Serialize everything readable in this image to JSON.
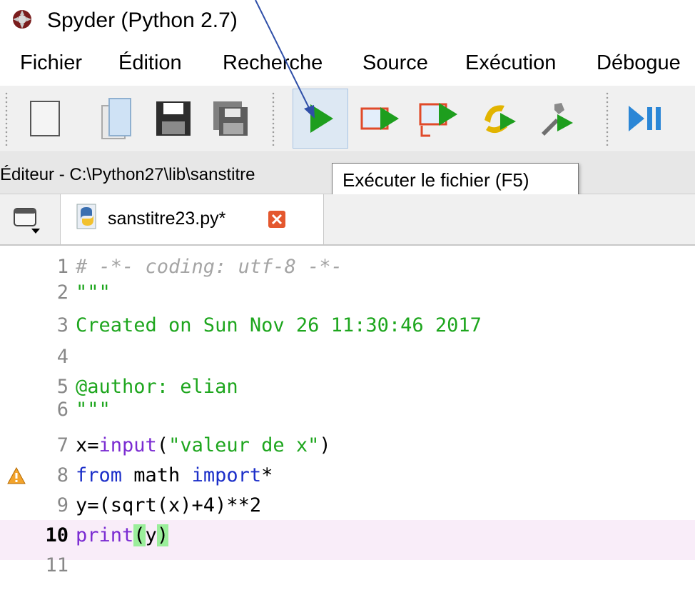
{
  "window": {
    "title": "Spyder (Python 2.7)"
  },
  "menu": {
    "items": [
      "Fichier",
      "Édition",
      "Recherche",
      "Source",
      "Exécution",
      "Débogue"
    ]
  },
  "toolbar": {
    "buttons": [
      "new-file-icon",
      "open-file-icon",
      "save-icon",
      "save-all-icon",
      "run-icon",
      "run-cell-icon",
      "run-cell-advance-icon",
      "run-selection-icon",
      "run-configuration-icon",
      "debug-icon"
    ],
    "accent": "#1ea61e"
  },
  "editor_header": {
    "path": "Éditeur - C:\\Python27\\lib\\sanstitre"
  },
  "tooltip": {
    "text": "Exécuter le fichier (F5)"
  },
  "tabs": [
    {
      "label": "sanstitre23.py*"
    }
  ],
  "code": {
    "lines": [
      {
        "n": "1",
        "text": "# -*- coding: utf-8 -*-"
      },
      {
        "n": "2",
        "text": "\"\"\""
      },
      {
        "n": "3",
        "text": "Created on Sun Nov 26 11:30:46 2017"
      },
      {
        "n": "4",
        "text": ""
      },
      {
        "n": "5",
        "text": "@author: elian"
      },
      {
        "n": "6",
        "text": "\"\"\""
      },
      {
        "n": "7",
        "text": "x=input(\"valeur de x\")"
      },
      {
        "n": "8",
        "text": "from math import*"
      },
      {
        "n": "9",
        "text": "y=(sqrt(x)+4)**2"
      },
      {
        "n": "10",
        "text": "print(y)"
      },
      {
        "n": "11",
        "text": ""
      }
    ],
    "current_line": "10",
    "warning_line": "8"
  }
}
